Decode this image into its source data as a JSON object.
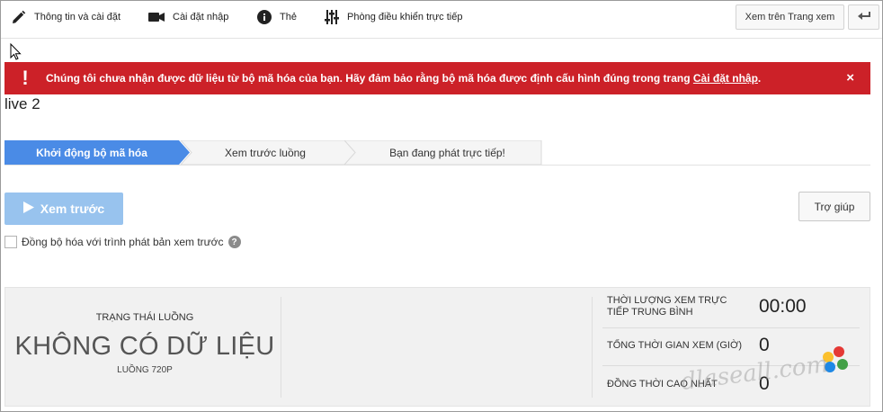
{
  "toolbar": {
    "info_label": "Thông tin và cài đặt",
    "ingest_label": "Cài đặt nhập",
    "cards_label": "Thẻ",
    "control_room_label": "Phòng điều khiển trực tiếp",
    "view_on_watch_label": "Xem trên Trang xem"
  },
  "banner": {
    "icon": "!",
    "message": "Chúng tôi chưa nhận được dữ liệu từ bộ mã hóa của bạn. Hãy đảm bảo rằng bộ mã hóa được định cấu hình đúng trong trang",
    "link_text": "Cài đặt nhập",
    "message_end": ".",
    "close_icon": "×",
    "color": "#cc2128"
  },
  "stream_title": "live 2",
  "steps": [
    {
      "label": "Khởi động bộ mã hóa",
      "active": true
    },
    {
      "label": "Xem trước luồng",
      "active": false
    },
    {
      "label": "Bạn đang phát trực tiếp!",
      "active": false
    }
  ],
  "actions": {
    "preview_label": "Xem trước",
    "help_label": "Trợ giúp",
    "sync_label": "Đồng bộ hóa với trình phát bản xem trước",
    "sync_checked": false,
    "help_icon": "?"
  },
  "stats": {
    "status_label": "TRẠNG THÁI LUỒNG",
    "status_value": "KHÔNG CÓ DỮ LIỆU",
    "status_sub": "LUỒNG 720P",
    "avg_watch_label": "THỜI LƯỢNG XEM TRỰC TIẾP TRUNG BÌNH",
    "avg_watch_value": "00:00",
    "total_watch_label": "TỔNG THỜI GIAN XEM (GIỜ)",
    "total_watch_value": "0",
    "peak_label": "ĐỒNG THỜI CAO NHẤT",
    "peak_value": "0"
  },
  "watermark": "dlaseall.com",
  "colors": {
    "accent_blue": "#4a8be6",
    "preview_blue": "#98c3ee"
  }
}
